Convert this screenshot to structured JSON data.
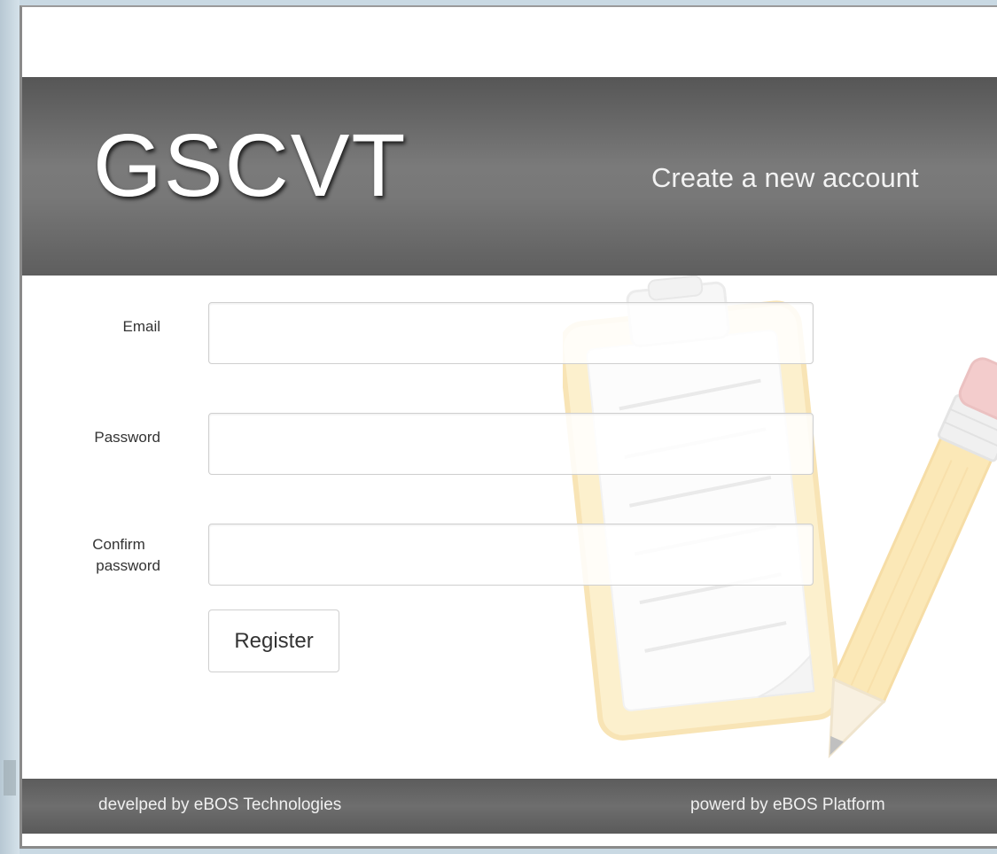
{
  "header": {
    "brand": "GSCVT",
    "subtitle": "Create a new account"
  },
  "form": {
    "email_label": "Email",
    "email_value": "",
    "password_label": "Password",
    "password_value": "",
    "confirm_label_line1": "Confirm",
    "confirm_label_line2": "password",
    "confirm_value": "",
    "register_label": "Register"
  },
  "footer": {
    "developed_by": "develped by eBOS Technologies",
    "powered_by": "powerd by eBOS Platform"
  },
  "icons": {
    "watermark": "clipboard-pencil-icon"
  },
  "colors": {
    "header_band": "#6e6e6e",
    "footer_band": "#606060",
    "clipboard_frame": "#f7d78a",
    "pencil_body": "#f9d77e",
    "eraser": "#e8a0a0"
  }
}
